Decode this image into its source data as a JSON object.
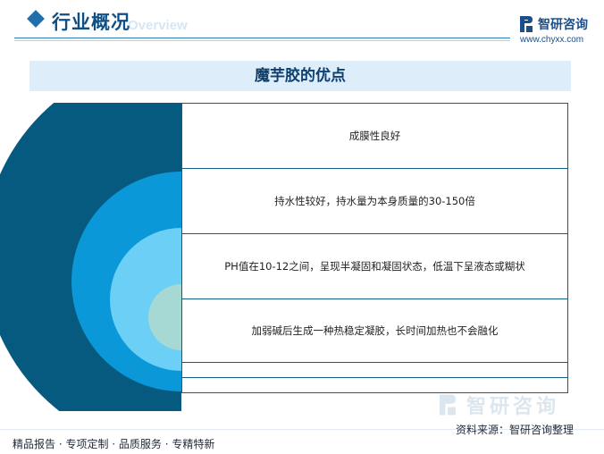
{
  "header": {
    "title": "行业概况",
    "subtitle": "Overview"
  },
  "logo": {
    "name": "智研咨询",
    "url": "www.chyxx.com",
    "icon": "chyxx-logo-icon"
  },
  "banner": {
    "title": "魔芋胶的优点"
  },
  "diagram": {
    "ring_colors": [
      "#075a7f",
      "#0a98d8",
      "#6ccff5",
      "#a6d9d3"
    ],
    "rows": [
      {
        "text": "成膜性良好"
      },
      {
        "text": "持水性较好，持水量为本身质量的30-150倍"
      },
      {
        "text": "PH值在10-12之间，呈现半凝固和凝固状态，低温下呈液态或糊状"
      },
      {
        "text": "加弱碱后生成一种热稳定凝胶，长时间加热也不会融化"
      },
      {
        "text": ""
      },
      {
        "text": ""
      }
    ]
  },
  "watermark": {
    "name": "智研咨询"
  },
  "footer": {
    "tagline": "精品报告 · 专项定制 · 品质服务 · 专精特新",
    "source": "资料来源：智研咨询整理"
  }
}
